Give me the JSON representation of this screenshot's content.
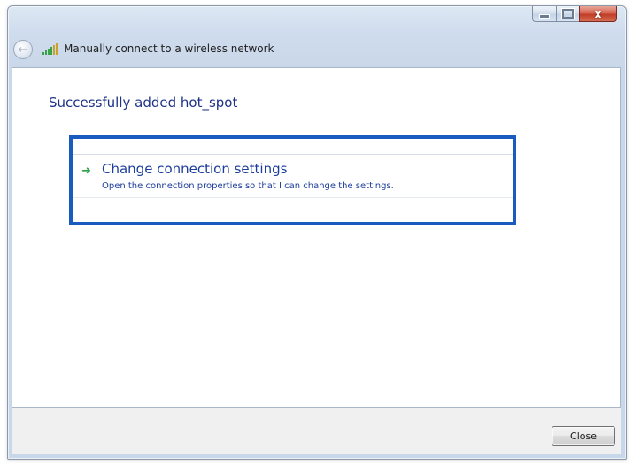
{
  "window": {
    "title": "Manually connect to a wireless network",
    "controls": {
      "minimize_icon": "minimize-icon",
      "maximize_icon": "maximize-icon",
      "close_glyph": "x"
    }
  },
  "nav": {
    "back_icon": "back-arrow-icon",
    "network_icon": "wireless-network-icon"
  },
  "main": {
    "heading": "Successfully added hot_spot",
    "option": {
      "icon": "green-arrow-icon",
      "title": "Change connection settings",
      "description": "Open the connection properties so that I can change the settings."
    }
  },
  "footer": {
    "close_label": "Close"
  },
  "colors": {
    "heading": "#1e3287",
    "link": "#1c3d9b",
    "highlight_border": "#1a5bbf",
    "arrow": "#2ea04a",
    "close_button_red": "#c03a24"
  }
}
